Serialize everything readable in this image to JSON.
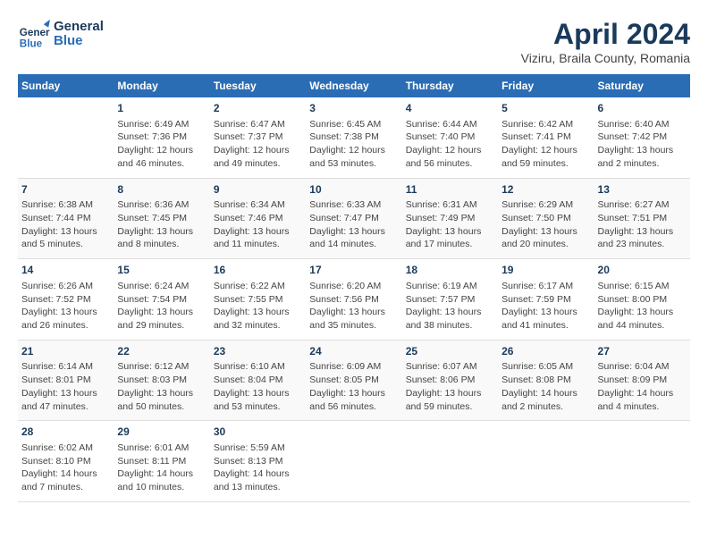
{
  "header": {
    "logo_line1": "General",
    "logo_line2": "Blue",
    "title": "April 2024",
    "subtitle": "Viziru, Braila County, Romania"
  },
  "calendar": {
    "days_of_week": [
      "Sunday",
      "Monday",
      "Tuesday",
      "Wednesday",
      "Thursday",
      "Friday",
      "Saturday"
    ],
    "weeks": [
      [
        {
          "day": "",
          "info": ""
        },
        {
          "day": "1",
          "info": "Sunrise: 6:49 AM\nSunset: 7:36 PM\nDaylight: 12 hours\nand 46 minutes."
        },
        {
          "day": "2",
          "info": "Sunrise: 6:47 AM\nSunset: 7:37 PM\nDaylight: 12 hours\nand 49 minutes."
        },
        {
          "day": "3",
          "info": "Sunrise: 6:45 AM\nSunset: 7:38 PM\nDaylight: 12 hours\nand 53 minutes."
        },
        {
          "day": "4",
          "info": "Sunrise: 6:44 AM\nSunset: 7:40 PM\nDaylight: 12 hours\nand 56 minutes."
        },
        {
          "day": "5",
          "info": "Sunrise: 6:42 AM\nSunset: 7:41 PM\nDaylight: 12 hours\nand 59 minutes."
        },
        {
          "day": "6",
          "info": "Sunrise: 6:40 AM\nSunset: 7:42 PM\nDaylight: 13 hours\nand 2 minutes."
        }
      ],
      [
        {
          "day": "7",
          "info": "Sunrise: 6:38 AM\nSunset: 7:44 PM\nDaylight: 13 hours\nand 5 minutes."
        },
        {
          "day": "8",
          "info": "Sunrise: 6:36 AM\nSunset: 7:45 PM\nDaylight: 13 hours\nand 8 minutes."
        },
        {
          "day": "9",
          "info": "Sunrise: 6:34 AM\nSunset: 7:46 PM\nDaylight: 13 hours\nand 11 minutes."
        },
        {
          "day": "10",
          "info": "Sunrise: 6:33 AM\nSunset: 7:47 PM\nDaylight: 13 hours\nand 14 minutes."
        },
        {
          "day": "11",
          "info": "Sunrise: 6:31 AM\nSunset: 7:49 PM\nDaylight: 13 hours\nand 17 minutes."
        },
        {
          "day": "12",
          "info": "Sunrise: 6:29 AM\nSunset: 7:50 PM\nDaylight: 13 hours\nand 20 minutes."
        },
        {
          "day": "13",
          "info": "Sunrise: 6:27 AM\nSunset: 7:51 PM\nDaylight: 13 hours\nand 23 minutes."
        }
      ],
      [
        {
          "day": "14",
          "info": "Sunrise: 6:26 AM\nSunset: 7:52 PM\nDaylight: 13 hours\nand 26 minutes."
        },
        {
          "day": "15",
          "info": "Sunrise: 6:24 AM\nSunset: 7:54 PM\nDaylight: 13 hours\nand 29 minutes."
        },
        {
          "day": "16",
          "info": "Sunrise: 6:22 AM\nSunset: 7:55 PM\nDaylight: 13 hours\nand 32 minutes."
        },
        {
          "day": "17",
          "info": "Sunrise: 6:20 AM\nSunset: 7:56 PM\nDaylight: 13 hours\nand 35 minutes."
        },
        {
          "day": "18",
          "info": "Sunrise: 6:19 AM\nSunset: 7:57 PM\nDaylight: 13 hours\nand 38 minutes."
        },
        {
          "day": "19",
          "info": "Sunrise: 6:17 AM\nSunset: 7:59 PM\nDaylight: 13 hours\nand 41 minutes."
        },
        {
          "day": "20",
          "info": "Sunrise: 6:15 AM\nSunset: 8:00 PM\nDaylight: 13 hours\nand 44 minutes."
        }
      ],
      [
        {
          "day": "21",
          "info": "Sunrise: 6:14 AM\nSunset: 8:01 PM\nDaylight: 13 hours\nand 47 minutes."
        },
        {
          "day": "22",
          "info": "Sunrise: 6:12 AM\nSunset: 8:03 PM\nDaylight: 13 hours\nand 50 minutes."
        },
        {
          "day": "23",
          "info": "Sunrise: 6:10 AM\nSunset: 8:04 PM\nDaylight: 13 hours\nand 53 minutes."
        },
        {
          "day": "24",
          "info": "Sunrise: 6:09 AM\nSunset: 8:05 PM\nDaylight: 13 hours\nand 56 minutes."
        },
        {
          "day": "25",
          "info": "Sunrise: 6:07 AM\nSunset: 8:06 PM\nDaylight: 13 hours\nand 59 minutes."
        },
        {
          "day": "26",
          "info": "Sunrise: 6:05 AM\nSunset: 8:08 PM\nDaylight: 14 hours\nand 2 minutes."
        },
        {
          "day": "27",
          "info": "Sunrise: 6:04 AM\nSunset: 8:09 PM\nDaylight: 14 hours\nand 4 minutes."
        }
      ],
      [
        {
          "day": "28",
          "info": "Sunrise: 6:02 AM\nSunset: 8:10 PM\nDaylight: 14 hours\nand 7 minutes."
        },
        {
          "day": "29",
          "info": "Sunrise: 6:01 AM\nSunset: 8:11 PM\nDaylight: 14 hours\nand 10 minutes."
        },
        {
          "day": "30",
          "info": "Sunrise: 5:59 AM\nSunset: 8:13 PM\nDaylight: 14 hours\nand 13 minutes."
        },
        {
          "day": "",
          "info": ""
        },
        {
          "day": "",
          "info": ""
        },
        {
          "day": "",
          "info": ""
        },
        {
          "day": "",
          "info": ""
        }
      ]
    ]
  }
}
